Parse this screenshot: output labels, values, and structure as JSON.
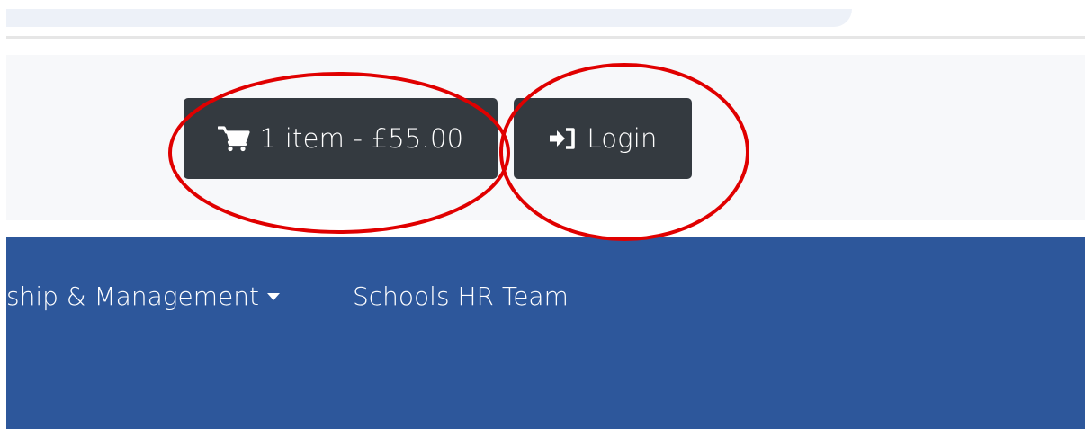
{
  "header": {
    "cart_button_label": "1 item - £55.00",
    "login_button_label": "Login"
  },
  "nav": {
    "items": [
      {
        "label": "ship & Management",
        "has_dropdown": true
      },
      {
        "label": "Schools HR Team",
        "has_dropdown": false
      }
    ]
  },
  "icons": {
    "cart": "shopping-cart-icon",
    "login": "sign-in-icon",
    "dropdown": "caret-down-icon"
  },
  "colors": {
    "button_bg": "#343a40",
    "nav_bg": "#2d579b",
    "header_bg": "#f7f8fa",
    "annotation": "#e00000"
  }
}
